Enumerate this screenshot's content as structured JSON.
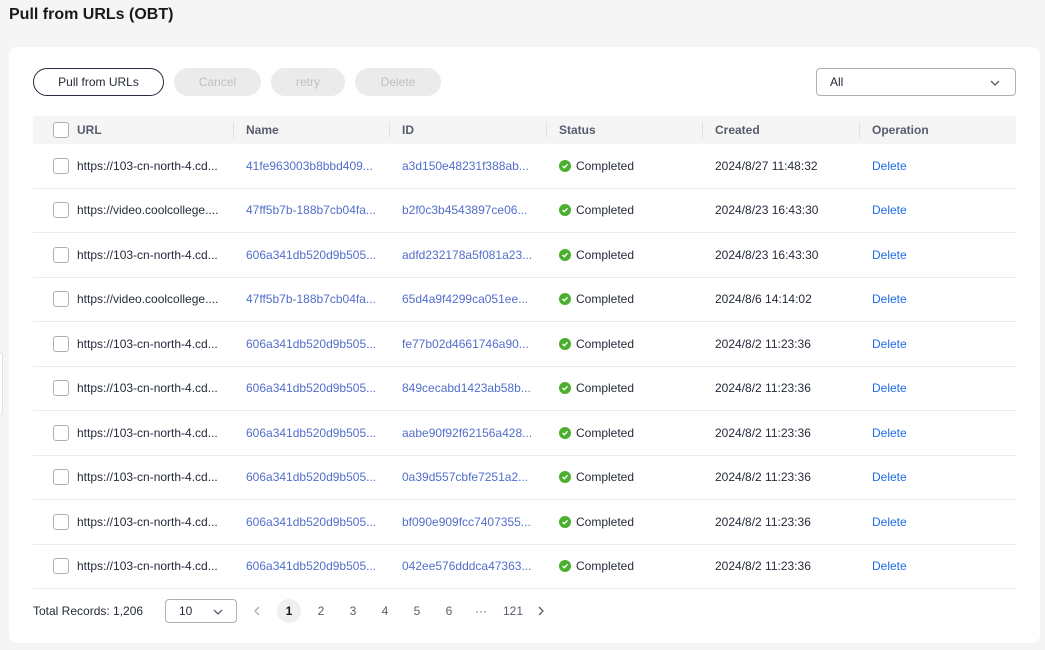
{
  "page": {
    "title": "Pull from URLs (OBT)"
  },
  "toolbar": {
    "pull_label": "Pull from URLs",
    "cancel_label": "Cancel",
    "retry_label": "retry",
    "delete_label": "Delete",
    "filter_value": "All"
  },
  "table": {
    "columns": {
      "url": "URL",
      "name": "Name",
      "id": "ID",
      "status": "Status",
      "created": "Created",
      "operation": "Operation"
    },
    "rows": [
      {
        "url": "https://103-cn-north-4.cd...",
        "name": "41fe963003b8bbd409...",
        "id": "a3d150e48231f388ab...",
        "status": "Completed",
        "created": "2024/8/27 11:48:32",
        "op": "Delete"
      },
      {
        "url": "https://video.coolcollege....",
        "name": "47ff5b7b-188b7cb04fa...",
        "id": "b2f0c3b4543897ce06...",
        "status": "Completed",
        "created": "2024/8/23 16:43:30",
        "op": "Delete"
      },
      {
        "url": "https://103-cn-north-4.cd...",
        "name": "606a341db520d9b505...",
        "id": "adfd232178a5f081a23...",
        "status": "Completed",
        "created": "2024/8/23 16:43:30",
        "op": "Delete"
      },
      {
        "url": "https://video.coolcollege....",
        "name": "47ff5b7b-188b7cb04fa...",
        "id": "65d4a9f4299ca051ee...",
        "status": "Completed",
        "created": "2024/8/6 14:14:02",
        "op": "Delete"
      },
      {
        "url": "https://103-cn-north-4.cd...",
        "name": "606a341db520d9b505...",
        "id": "fe77b02d4661746a90...",
        "status": "Completed",
        "created": "2024/8/2 11:23:36",
        "op": "Delete"
      },
      {
        "url": "https://103-cn-north-4.cd...",
        "name": "606a341db520d9b505...",
        "id": "849cecabd1423ab58b...",
        "status": "Completed",
        "created": "2024/8/2 11:23:36",
        "op": "Delete"
      },
      {
        "url": "https://103-cn-north-4.cd...",
        "name": "606a341db520d9b505...",
        "id": "aabe90f92f62156a428...",
        "status": "Completed",
        "created": "2024/8/2 11:23:36",
        "op": "Delete"
      },
      {
        "url": "https://103-cn-north-4.cd...",
        "name": "606a341db520d9b505...",
        "id": "0a39d557cbfe7251a2...",
        "status": "Completed",
        "created": "2024/8/2 11:23:36",
        "op": "Delete"
      },
      {
        "url": "https://103-cn-north-4.cd...",
        "name": "606a341db520d9b505...",
        "id": "bf090e909fcc7407355...",
        "status": "Completed",
        "created": "2024/8/2 11:23:36",
        "op": "Delete"
      },
      {
        "url": "https://103-cn-north-4.cd...",
        "name": "606a341db520d9b505...",
        "id": "042ee576dddca47363...",
        "status": "Completed",
        "created": "2024/8/2 11:23:36",
        "op": "Delete"
      }
    ]
  },
  "pagination": {
    "total_label": "Total Records: 1,206",
    "page_size": "10",
    "pages": [
      "1",
      "2",
      "3",
      "4",
      "5",
      "6",
      "···",
      "121"
    ],
    "current_page": "1"
  },
  "colors": {
    "link": "#526ecc",
    "status_ok": "#4cae2f",
    "disabled_bg": "#ebebeb",
    "header_bg": "#f5f5f6"
  },
  "icons": {
    "chevron_down": "chevron-down-icon",
    "chevron_left": "chevron-left-icon",
    "chevron_right": "chevron-right-icon",
    "status_completed": "check-circle-icon"
  }
}
